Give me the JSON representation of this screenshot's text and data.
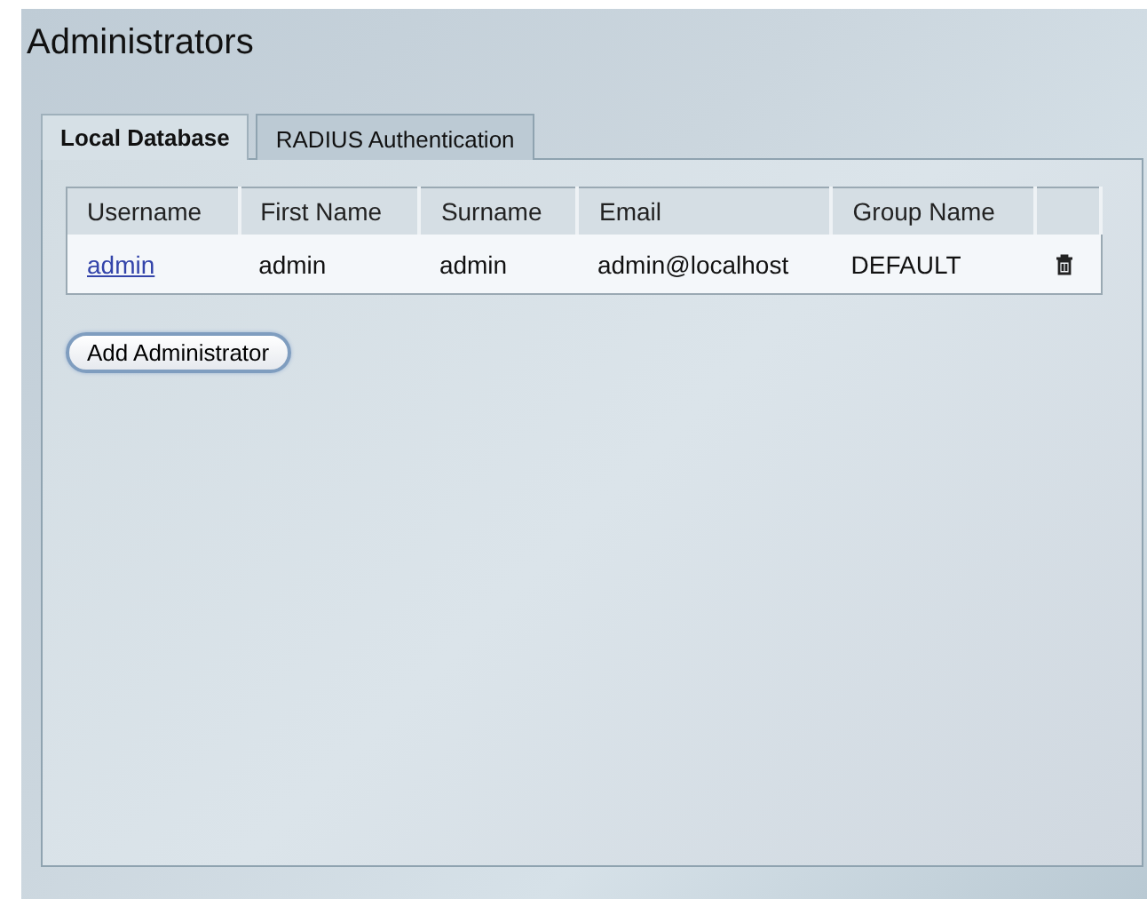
{
  "title": "Administrators",
  "tabs": [
    {
      "label": "Local Database",
      "selected": true
    },
    {
      "label": "RADIUS Authentication",
      "selected": false
    }
  ],
  "table": {
    "columns": [
      "Username",
      "First Name",
      "Surname",
      "Email",
      "Group Name"
    ],
    "rows": [
      {
        "username": "admin",
        "first_name": "admin",
        "surname": "admin",
        "email": "admin@localhost",
        "group_name": "DEFAULT"
      }
    ]
  },
  "add_button": "Add Administrator"
}
